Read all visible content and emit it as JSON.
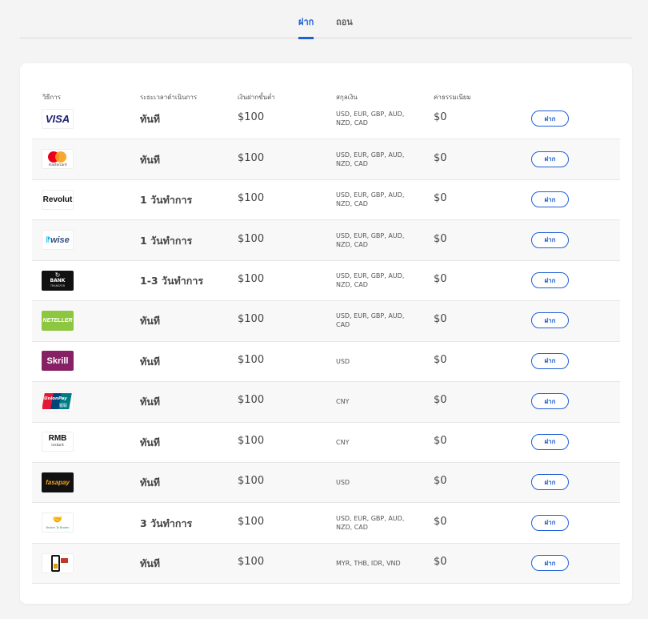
{
  "tabs": [
    {
      "label": "ฝาก",
      "active": true
    },
    {
      "label": "ถอน",
      "active": false
    }
  ],
  "table": {
    "headers": [
      "วิธีการ",
      "ระยะเวลาดำเนินการ",
      "เงินฝากขั้นต่ำ",
      "สกุลเงิน",
      "ค่าธรรมเนียม"
    ],
    "rows": [
      {
        "logo": "visa-logo",
        "logo_text": "VISA",
        "time": "ทันที",
        "min": "$100",
        "currency": "USD, EUR, GBP, AUD, NZD, CAD",
        "fee": "$0",
        "button": "ฝาก"
      },
      {
        "logo": "mastercard-logo",
        "logo_text": "mastercard",
        "time": "ทันที",
        "min": "$100",
        "currency": "USD, EUR, GBP, AUD, NZD, CAD",
        "fee": "$0",
        "button": "ฝาก"
      },
      {
        "logo": "revolut-logo",
        "logo_text": "Revolut",
        "time": "1 วันทำการ",
        "min": "$100",
        "currency": "USD, EUR, GBP, AUD, NZD, CAD",
        "fee": "$0",
        "button": "ฝาก"
      },
      {
        "logo": "wise-logo",
        "logo_text": "wise",
        "time": "1 วันทำการ",
        "min": "$100",
        "currency": "USD, EUR, GBP, AUD, NZD, CAD",
        "fee": "$0",
        "button": "ฝาก"
      },
      {
        "logo": "bank-transfer-logo",
        "logo_text": "BANK",
        "logo_subtext": "TRANSFER",
        "time": "1-3 วันทำการ",
        "min": "$100",
        "currency": "USD, EUR, GBP, AUD, NZD, CAD",
        "fee": "$0",
        "button": "ฝาก"
      },
      {
        "logo": "neteller-logo",
        "logo_text": "NETELLER",
        "time": "ทันที",
        "min": "$100",
        "currency": "USD, EUR, GBP, AUD, CAD",
        "fee": "$0",
        "button": "ฝาก"
      },
      {
        "logo": "skrill-logo",
        "logo_text": "Skrill",
        "time": "ทันที",
        "min": "$100",
        "currency": "USD",
        "fee": "$0",
        "button": "ฝาก"
      },
      {
        "logo": "unionpay-logo",
        "logo_text": "UnionPay",
        "logo_subtext": "银联",
        "time": "ทันที",
        "min": "$100",
        "currency": "CNY",
        "fee": "$0",
        "button": "ฝาก"
      },
      {
        "logo": "rmb-instant-logo",
        "logo_text": "RMB",
        "logo_subtext": "instant",
        "time": "ทันที",
        "min": "$100",
        "currency": "CNY",
        "fee": "$0",
        "button": "ฝาก"
      },
      {
        "logo": "fasapay-logo",
        "logo_text": "fasapay",
        "time": "ทันที",
        "min": "$100",
        "currency": "USD",
        "fee": "$0",
        "button": "ฝาก"
      },
      {
        "logo": "broker-to-broker-logo",
        "logo_text": "Broker To Broker",
        "time": "3 วันทำการ",
        "min": "$100",
        "currency": "USD, EUR, GBP, AUD, NZD, CAD",
        "fee": "$0",
        "button": "ฝาก"
      },
      {
        "logo": "mobile-banking-logo",
        "logo_text": "",
        "time": "ทันที",
        "min": "$100",
        "currency": "MYR, THB, IDR, VND",
        "fee": "$0",
        "button": "ฝาก"
      }
    ]
  },
  "colors": {
    "accent": "#1f5fd6",
    "visa": "#1a1f71",
    "skrill": "#862165",
    "neteller": "#8dc63f"
  }
}
